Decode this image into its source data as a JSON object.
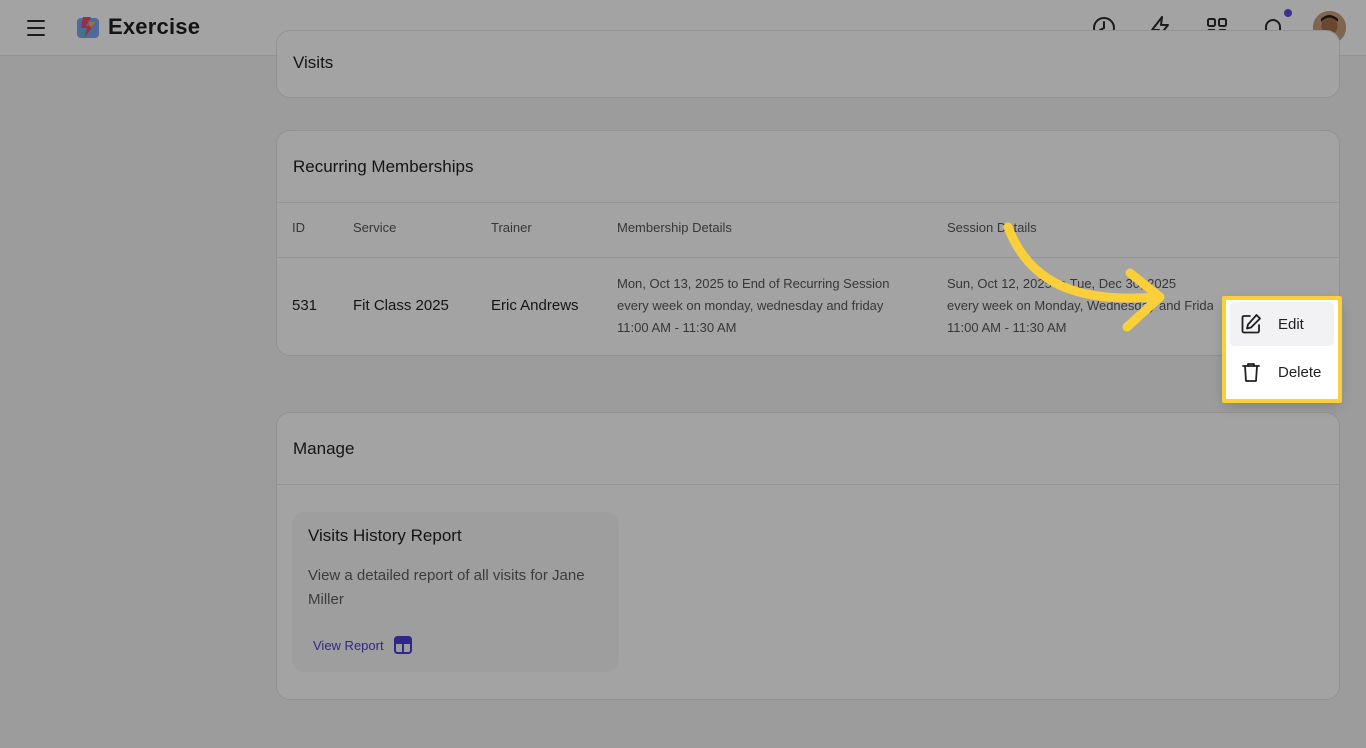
{
  "app": {
    "title": "Exercise"
  },
  "topbar": {
    "icons": [
      "clock-icon",
      "lightning-icon",
      "apps-grid-icon",
      "bell-icon"
    ],
    "has_notification": true
  },
  "visits_card": {
    "title": "Visits"
  },
  "recurring": {
    "title": "Recurring Memberships",
    "columns": [
      "ID",
      "Service",
      "Trainer",
      "Membership Details",
      "Session Details"
    ],
    "row": {
      "id": "531",
      "service": "Fit Class 2025",
      "trainer": "Eric Andrews",
      "membership_line1": "Mon, Oct 13, 2025 to End of Recurring Session",
      "membership_line2": "every week on monday, wednesday and friday",
      "membership_line3": "11:00 AM - 11:30 AM",
      "session_line1": "Sun, Oct 12, 2025 to Tue, Dec 30, 2025",
      "session_line2": "every week on Monday, Wednesday and Friday",
      "session_line3": "11:00 AM - 11:30 AM"
    }
  },
  "manage": {
    "title": "Manage",
    "report": {
      "title": "Visits History Report",
      "description": "View a detailed report of all visits for Jane Miller",
      "link_label": "View Report"
    }
  },
  "dropdown": {
    "items": [
      {
        "label": "Edit",
        "icon": "edit-icon"
      },
      {
        "label": "Delete",
        "icon": "trash-icon"
      }
    ]
  },
  "colors": {
    "accent": "#4b3fd6",
    "highlight": "#f9cf3a",
    "notification": "#5b4ce0"
  }
}
